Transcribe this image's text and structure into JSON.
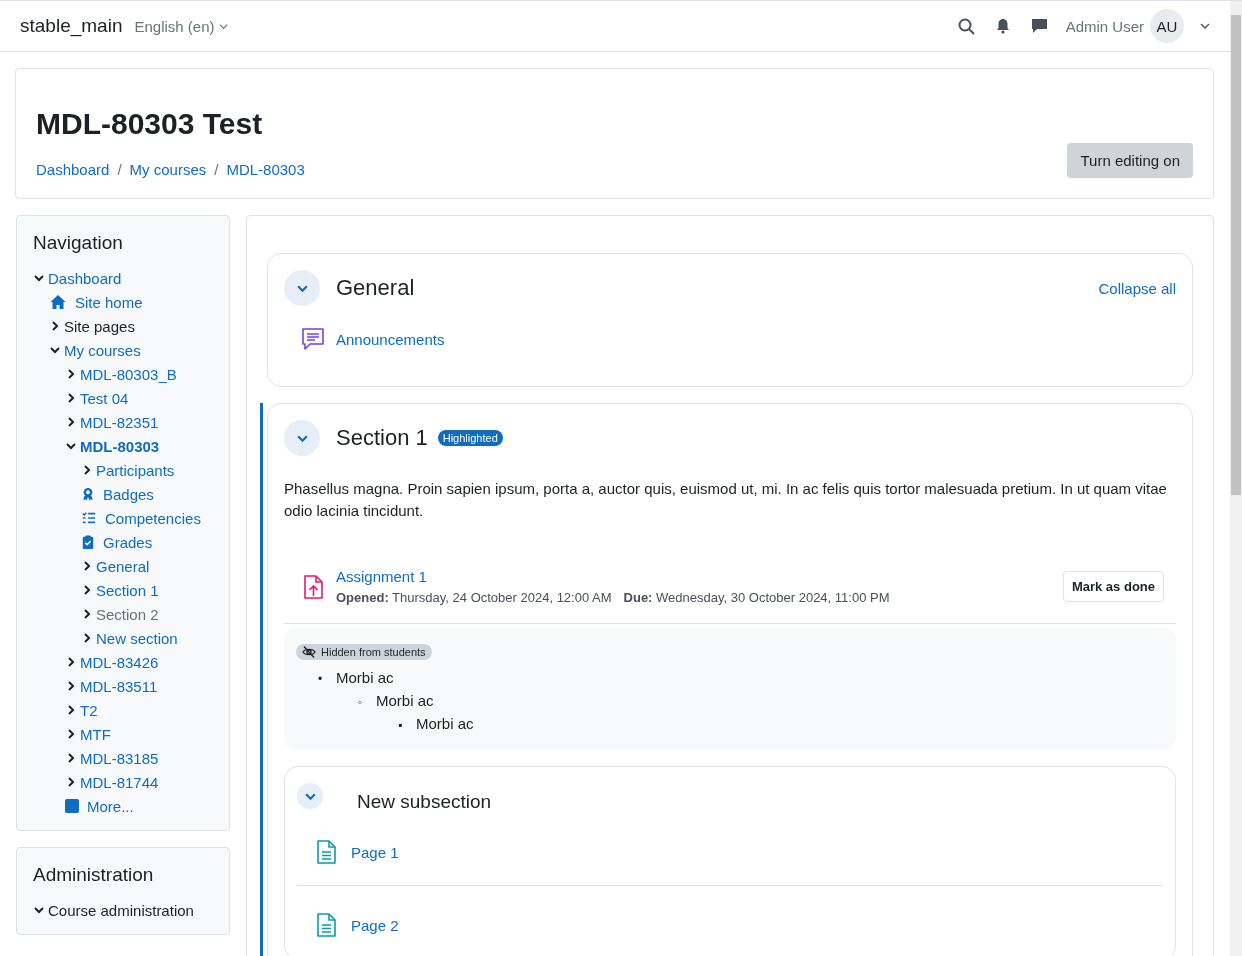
{
  "site": {
    "name": "stable_main",
    "language": "English (en)"
  },
  "user": {
    "name": "Admin User",
    "initials": "AU"
  },
  "header": {
    "title": "MDL-80303 Test",
    "breadcrumb": [
      "Dashboard",
      "My courses",
      "MDL-80303"
    ],
    "separator": "/",
    "edit_button": "Turn editing on"
  },
  "navigation": {
    "title": "Navigation",
    "items": [
      {
        "kind": "branch",
        "label": "Dashboard",
        "link": true,
        "expanded": true,
        "children": [
          {
            "kind": "home",
            "label": "Site home",
            "link": true
          },
          {
            "kind": "branch",
            "label": "Site pages",
            "link": false,
            "expanded": false
          },
          {
            "kind": "branch",
            "label": "My courses",
            "link": true,
            "expanded": true,
            "children": [
              {
                "kind": "branch",
                "label": "MDL-80303_B",
                "link": true,
                "expanded": false
              },
              {
                "kind": "branch",
                "label": "Test 04",
                "link": true,
                "expanded": false
              },
              {
                "kind": "branch",
                "label": "MDL-82351",
                "link": true,
                "expanded": false
              },
              {
                "kind": "branch",
                "label": "MDL-80303",
                "link": true,
                "expanded": true,
                "current": true,
                "children": [
                  {
                    "kind": "branch",
                    "label": "Participants",
                    "link": true,
                    "expanded": false
                  },
                  {
                    "kind": "badge",
                    "label": "Badges",
                    "link": true
                  },
                  {
                    "kind": "competencies",
                    "label": "Competencies",
                    "link": true
                  },
                  {
                    "kind": "grades",
                    "label": "Grades",
                    "link": true
                  },
                  {
                    "kind": "branch",
                    "label": "General",
                    "link": true,
                    "expanded": false
                  },
                  {
                    "kind": "branch",
                    "label": "Section 1",
                    "link": true,
                    "expanded": false
                  },
                  {
                    "kind": "branch",
                    "label": "Section 2",
                    "link": true,
                    "expanded": false,
                    "dimmed": true
                  },
                  {
                    "kind": "branch",
                    "label": "New section",
                    "link": true,
                    "expanded": false
                  }
                ]
              },
              {
                "kind": "branch",
                "label": "MDL-83426",
                "link": true,
                "expanded": false
              },
              {
                "kind": "branch",
                "label": "MDL-83511",
                "link": true,
                "expanded": false
              },
              {
                "kind": "branch",
                "label": "T2",
                "link": true,
                "expanded": false
              },
              {
                "kind": "branch",
                "label": "MTF",
                "link": true,
                "expanded": false
              },
              {
                "kind": "branch",
                "label": "MDL-83185",
                "link": true,
                "expanded": false
              },
              {
                "kind": "branch",
                "label": "MDL-81744",
                "link": true,
                "expanded": false
              },
              {
                "kind": "more",
                "label": "More...",
                "link": true
              }
            ]
          }
        ]
      }
    ]
  },
  "administration": {
    "title": "Administration",
    "items": [
      {
        "kind": "branch",
        "label": "Course administration",
        "link": false,
        "expanded": true
      }
    ]
  },
  "collapse_all": "Collapse all",
  "sections": [
    {
      "title": "General",
      "expanded": true,
      "highlighted": false,
      "activities": [
        {
          "kind": "forum",
          "name": "Announcements"
        }
      ]
    },
    {
      "title": "Section 1",
      "expanded": true,
      "highlighted": true,
      "badge": "Highlighted",
      "summary": "Phasellus magna. Proin sapien ipsum, porta a, auctor quis, euismod ut, mi. In ac felis quis tortor malesuada pretium. In ut quam vitae odio lacinia tincidunt.",
      "activities": [
        {
          "kind": "assignment",
          "name": "Assignment 1",
          "dates": [
            "**Opened:** Thursday, 24 October 2024, 12:00 AM",
            "**Due:** Wednesday, 30 October 2024, 11:00 PM"
          ],
          "button": "Mark as done"
        },
        {
          "kind": "text",
          "badge": "Hidden from students",
          "list": [
            {
              "marker": "•",
              "text": "Morbi ac",
              "children": [
                {
                  "marker": "◦",
                  "text": "Morbi ac",
                  "children": [
                    {
                      "marker": "▪",
                      "text": "Morbi ac"
                    }
                  ]
                }
              ]
            }
          ]
        },
        {
          "kind": "subsection",
          "title": "New subsection",
          "expanded": true,
          "activities": [
            {
              "kind": "page",
              "name": "Page 1"
            },
            {
              "kind": "page",
              "name": "Page 2"
            }
          ]
        }
      ]
    }
  ]
}
